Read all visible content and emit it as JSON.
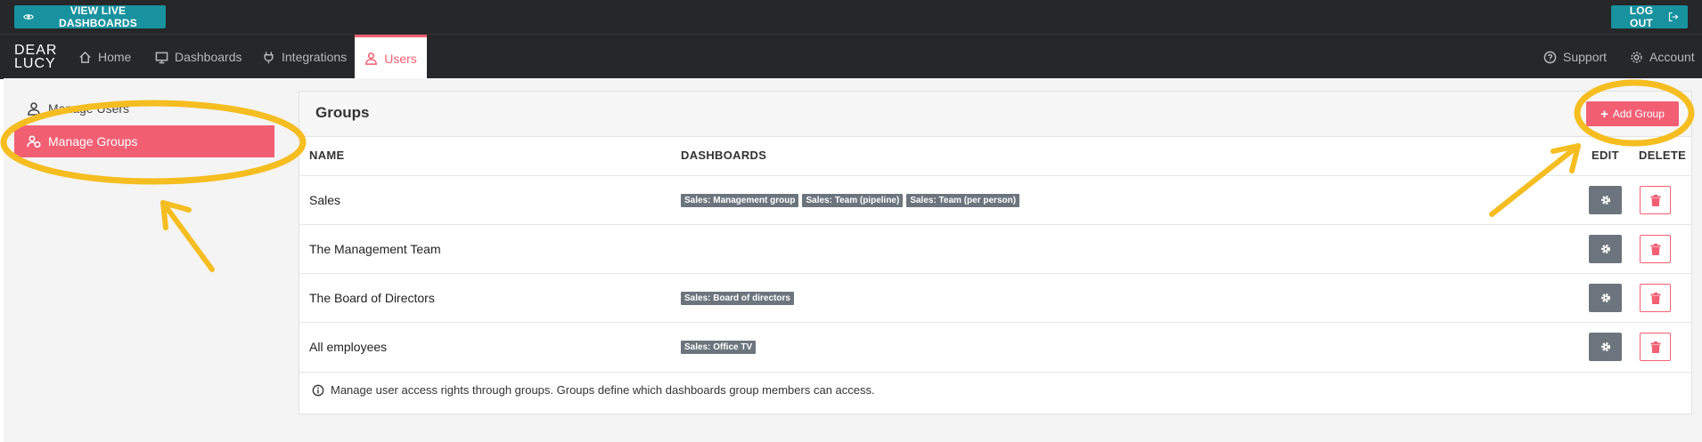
{
  "topbar": {
    "live_label": "VIEW LIVE DASHBOARDS",
    "logout_label": "LOG OUT"
  },
  "logo": {
    "line1": "DEAR",
    "line2": "LUCY"
  },
  "nav": {
    "home": "Home",
    "dashboards": "Dashboards",
    "integrations": "Integrations",
    "users": "Users",
    "support": "Support",
    "account": "Account"
  },
  "sidebar": {
    "items": [
      {
        "label": "Manage Users"
      },
      {
        "label": "Manage Groups"
      }
    ]
  },
  "panel": {
    "title": "Groups",
    "add_label": "Add Group",
    "columns": {
      "name": "NAME",
      "dashboards": "DASHBOARDS",
      "edit": "EDIT",
      "delete": "DELETE"
    },
    "rows": [
      {
        "name": "Sales",
        "tags": [
          "Sales: Management group",
          "Sales: Team (pipeline)",
          "Sales: Team (per person)"
        ]
      },
      {
        "name": "The Management Team",
        "tags": []
      },
      {
        "name": "The Board of Directors",
        "tags": [
          "Sales: Board of directors"
        ]
      },
      {
        "name": "All employees",
        "tags": [
          "Sales: Office TV"
        ]
      }
    ],
    "info": "Manage user access rights through groups. Groups define which dashboards group members can access."
  },
  "colors": {
    "accent": "#f25f73",
    "teal": "#17929e",
    "dark": "#262729",
    "annotation": "#f5bd1f"
  }
}
